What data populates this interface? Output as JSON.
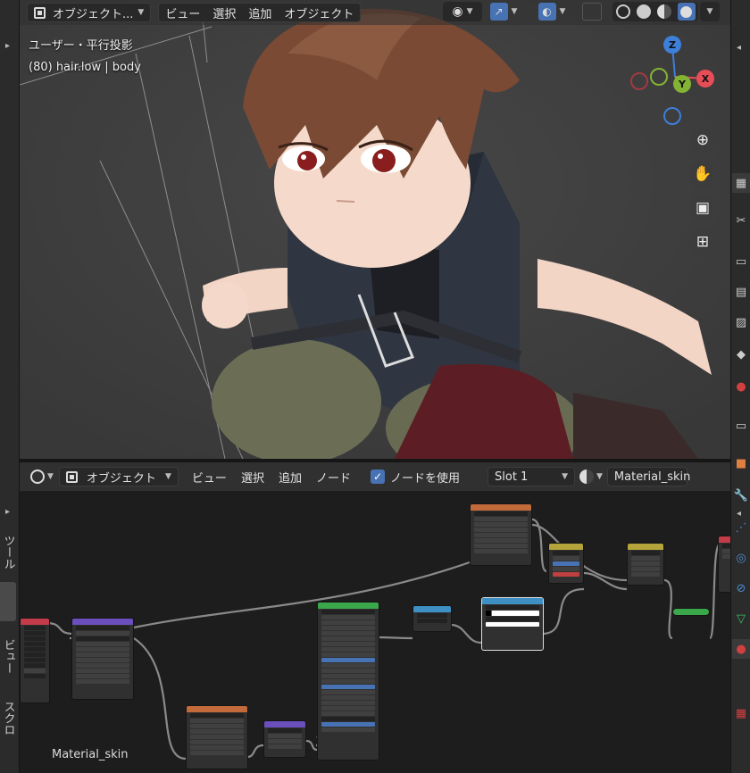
{
  "viewport": {
    "mode_label": "オブジェクト...",
    "menus": [
      "ビュー",
      "選択",
      "追加",
      "オブジェクト"
    ],
    "view_title": "ユーザー・平行投影",
    "active_object": "(80) hair.low | body",
    "axes": {
      "z": "Z",
      "y": "Y",
      "x": "X"
    }
  },
  "node_editor": {
    "mode_label": "オブジェクト",
    "menus": [
      "ビュー",
      "選択",
      "追加",
      "ノード"
    ],
    "use_nodes_label": "ノードを使用",
    "use_nodes_checked": true,
    "slot_label": "Slot 1",
    "material_name": "Material_skin",
    "canvas_label": "Material_skin"
  },
  "left_tabs": [
    "ツール",
    "ビュー",
    "スクロ"
  ],
  "colors": {
    "accent": "#4772b3",
    "axis_x": "#e64d57",
    "axis_y": "#84b334",
    "axis_z": "#3d7fd9"
  }
}
